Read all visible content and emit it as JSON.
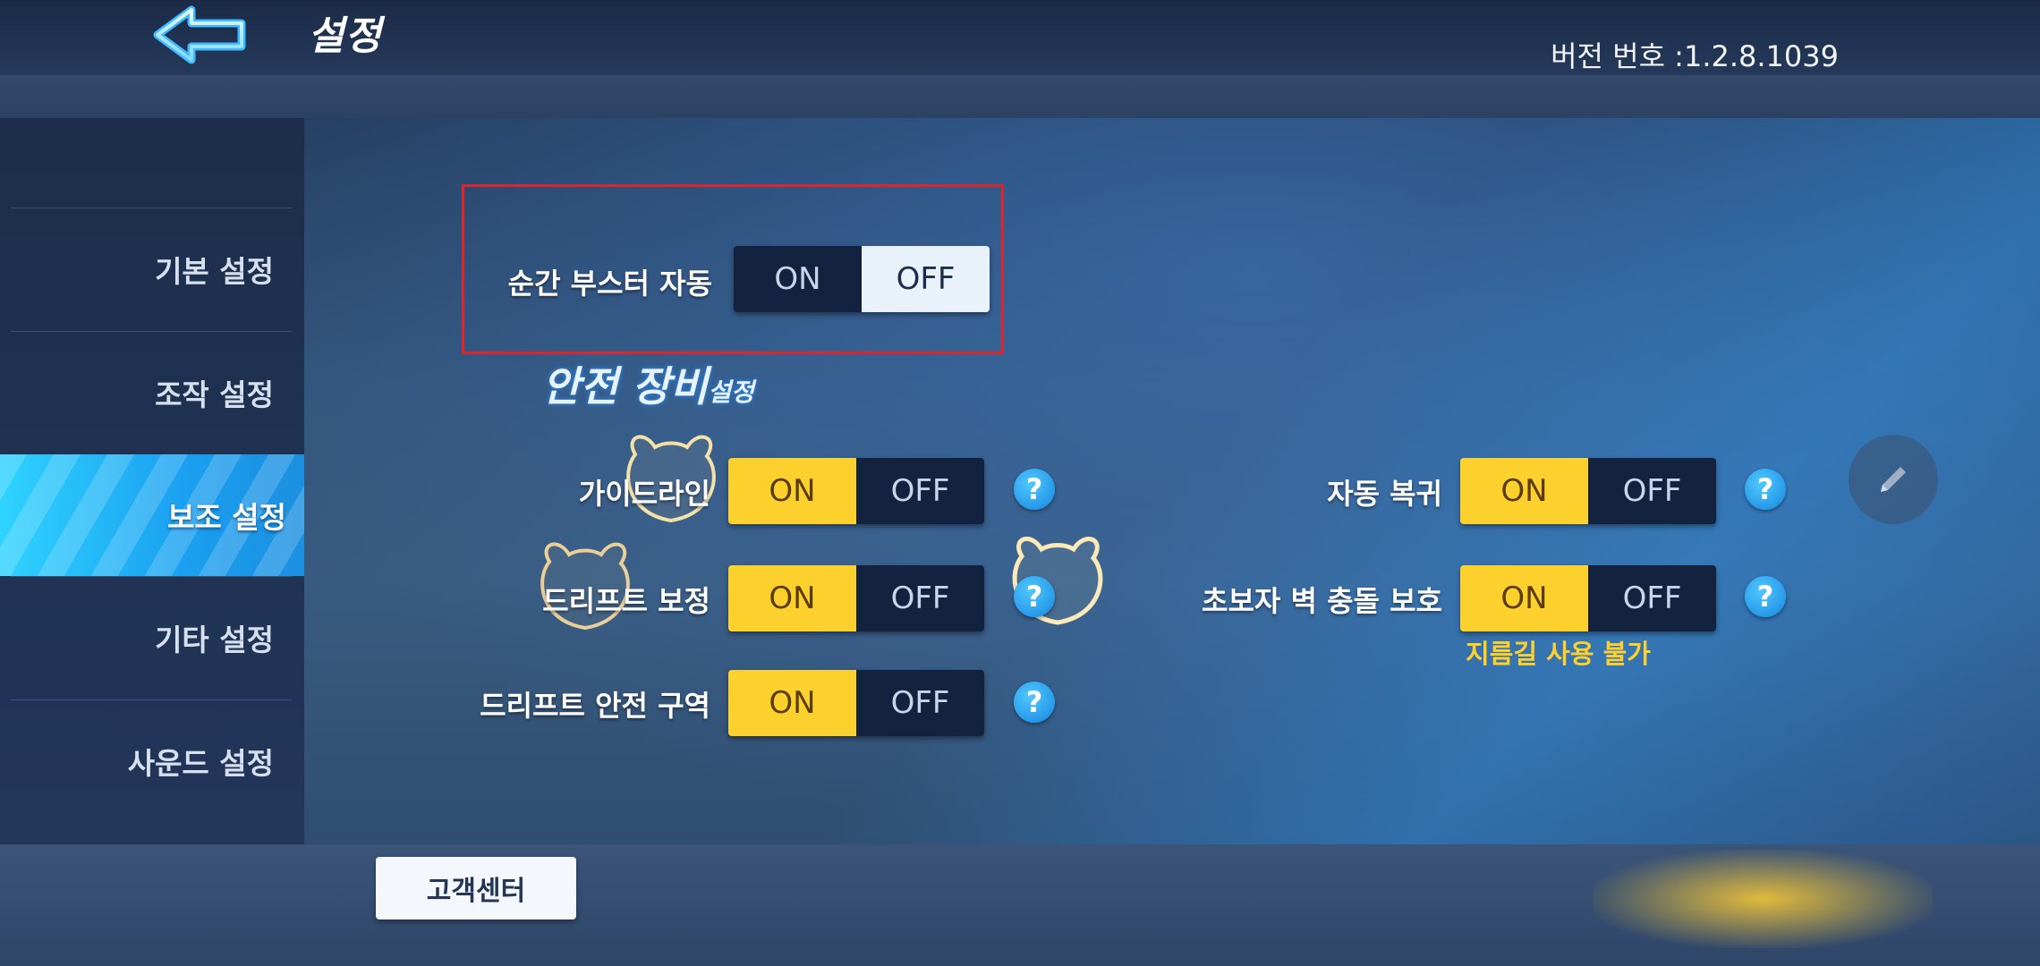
{
  "header": {
    "title": "설정",
    "version": "버전 번호 :1.2.8.1039"
  },
  "sidebar": {
    "items": [
      {
        "label": "기본 설정",
        "active": false
      },
      {
        "label": "조작 설정",
        "active": false
      },
      {
        "label": "보조 설정",
        "active": true
      },
      {
        "label": "기타 설정",
        "active": false
      },
      {
        "label": "사운드 설정",
        "active": false
      }
    ]
  },
  "toggle_labels": {
    "on": "ON",
    "off": "OFF"
  },
  "settings": {
    "instant_booster": {
      "label": "순간 부스터 자동",
      "value": "OFF"
    },
    "section_title_big": "안전 장비",
    "section_title_small": "설정",
    "guideline": {
      "label": "가이드라인",
      "value": "ON"
    },
    "drift_correction": {
      "label": "드리프트 보정",
      "value": "ON"
    },
    "drift_safe_zone": {
      "label": "드리프트 안전 구역",
      "value": "ON"
    },
    "auto_recovery": {
      "label": "자동 복귀",
      "value": "ON"
    },
    "beginner_wall_protection": {
      "label": "초보자 벽 충돌 보호",
      "value": "ON",
      "note": "지름길 사용 불가"
    }
  },
  "help_glyph": "?",
  "footer": {
    "support_label": "고객센터"
  },
  "colors": {
    "accent_yellow": "#fcd12e",
    "highlight_red": "#e0242c",
    "active_tab_blue": "#2fd3ff"
  }
}
